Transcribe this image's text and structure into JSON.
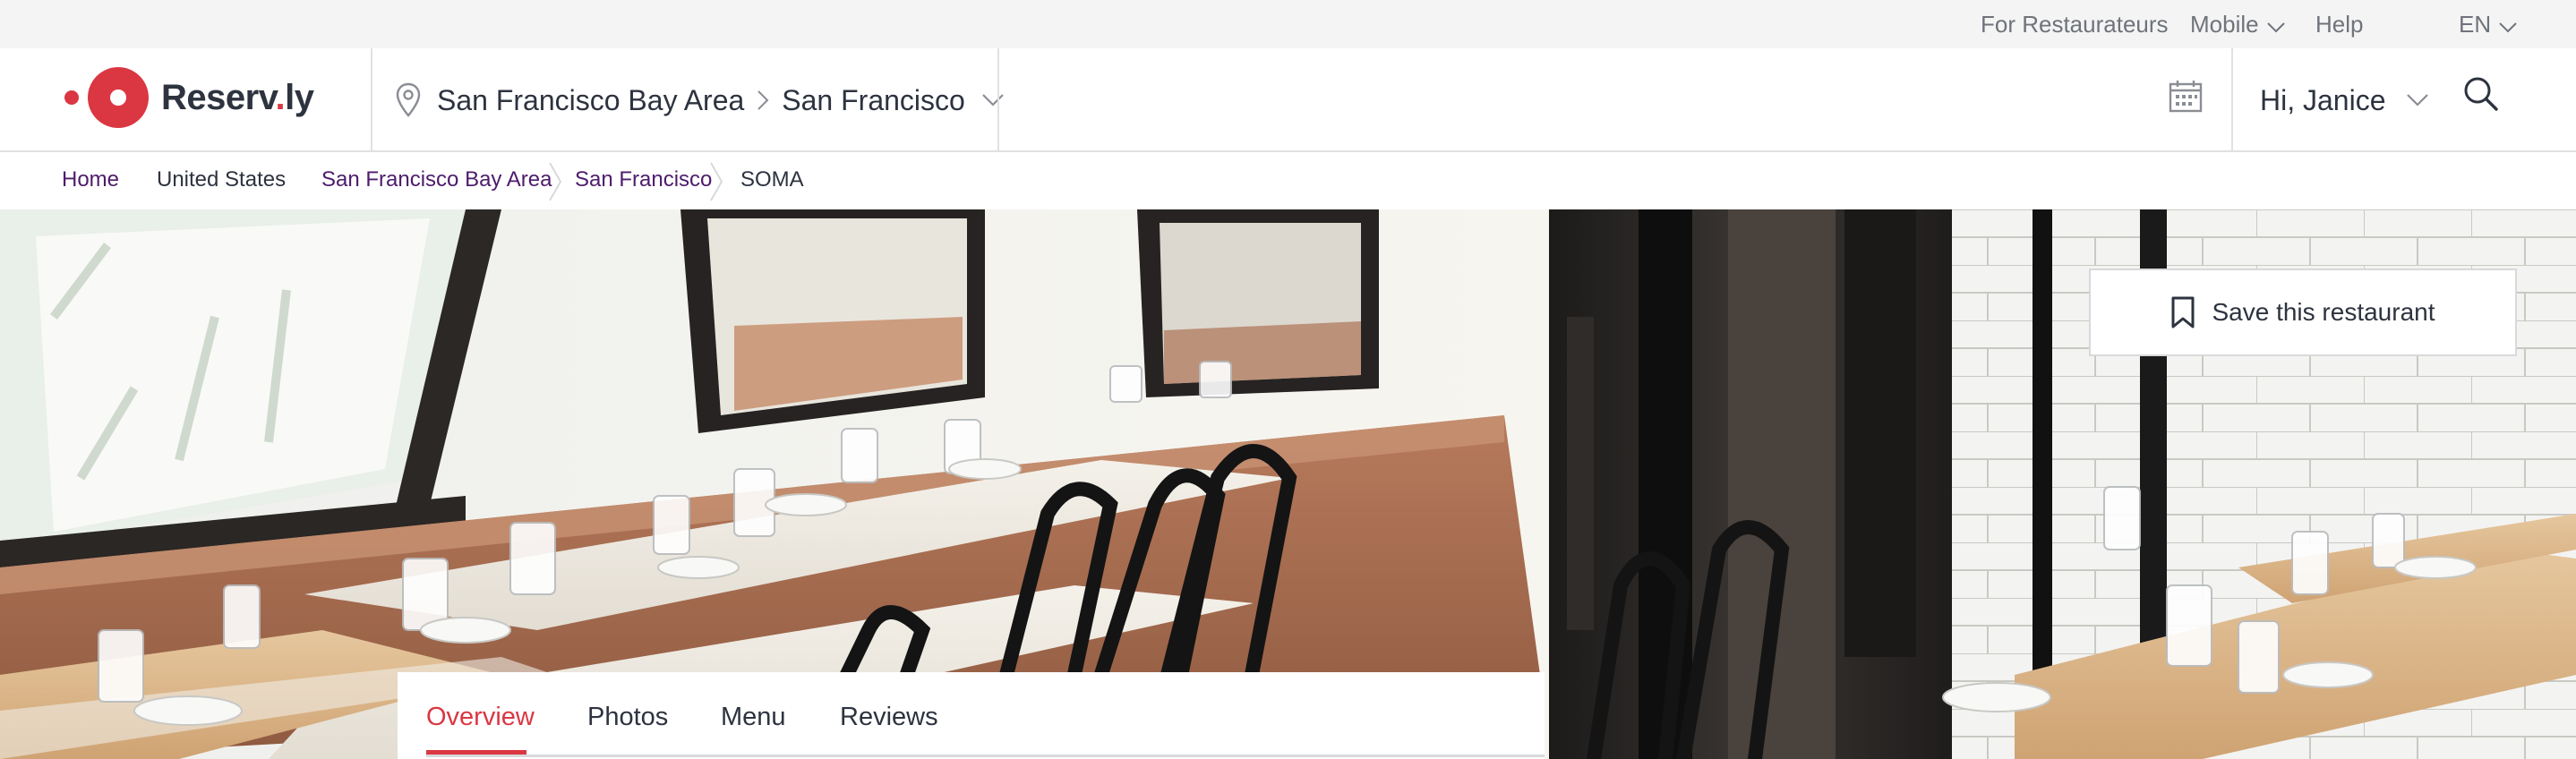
{
  "utility_bar": {
    "for_restaurateurs": "For Restaurateurs",
    "mobile": "Mobile",
    "help": "Help",
    "language": "EN"
  },
  "header": {
    "logo_text_prefix": "Reserv",
    "logo_text_dot": ".",
    "logo_text_suffix": "ly",
    "location_region": "San Francisco Bay Area",
    "location_city": "San Francisco",
    "user_greeting": "Hi, Janice",
    "icons": [
      "location-pin-icon",
      "chevron-right-icon",
      "chevron-down-icon",
      "calendar-icon",
      "search-icon"
    ]
  },
  "breadcrumb": {
    "items": [
      "Home",
      "United States",
      "San Francisco Bay Area",
      "San Francisco",
      "SOMA"
    ]
  },
  "hero": {
    "save_label": "Save this restaurant"
  },
  "tabs": {
    "items": [
      "Overview",
      "Photos",
      "Menu",
      "Reviews"
    ],
    "active": "Overview"
  },
  "colors": {
    "brand_red": "#da3743",
    "breadcrumb_link": "#4d1c6b",
    "utility_bg": "#f4f4f4",
    "text": "#2d333f"
  }
}
